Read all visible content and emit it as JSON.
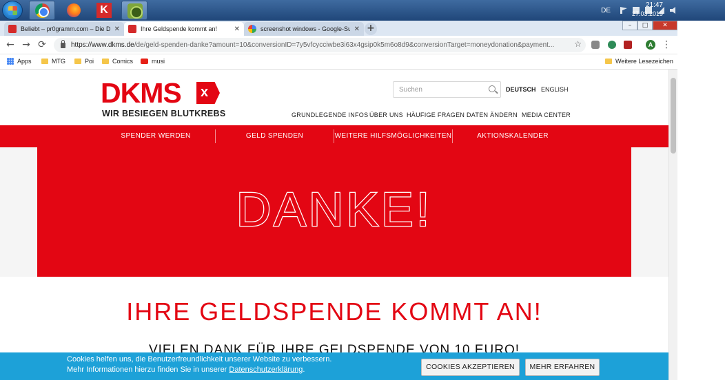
{
  "taskbar": {
    "tray_language": "DE",
    "clock_time": "21:47",
    "clock_date": "27.03.2019"
  },
  "window": {
    "minimize": "–",
    "maximize": "□",
    "close": "✕"
  },
  "tabs": [
    {
      "title": "Beliebt – pr0gramm.com – Die D",
      "active": false
    },
    {
      "title": "Ihre Geldspende kommt an!",
      "active": true
    },
    {
      "title": "screenshot windows - Google-Su",
      "active": false
    }
  ],
  "new_tab_label": "+",
  "toolbar": {
    "back": "←",
    "forward": "→",
    "reload": "⟳",
    "url_host": "https://www.dkms.de",
    "url_path": "/de/geld-spenden-danke?amount=10&conversionID=7y5vfcycciwbe3i63x4gsip0k5m6o8d9&conversionTarget=moneydonation&payment...",
    "star": "☆",
    "profile_initial": "A",
    "menu": "⋮"
  },
  "bookmarks": {
    "items": [
      "Apps",
      "MTG",
      "Poi",
      "Comics",
      "musi"
    ],
    "other": "Weitere Lesezeichen"
  },
  "site": {
    "logo": "DKMS",
    "logo_mark": "x",
    "tagline": "WIR BESIEGEN BLUTKREBS",
    "search_placeholder": "Suchen",
    "languages": [
      "DEUTSCH",
      "ENGLISH"
    ],
    "meta_nav": [
      "GRUNDLEGENDE INFOS",
      "ÜBER UNS",
      "HÄUFIGE FRAGEN",
      "DATEN ÄNDERN",
      "MEDIA CENTER"
    ],
    "main_nav": [
      "SPENDER WERDEN",
      "GELD SPENDEN",
      "WEITERE HILFSMÖGLICHKEITEN",
      "AKTIONSKALENDER"
    ],
    "hero_title": "DANKE!",
    "heading": "IHRE GELDSPENDE KOMMT AN!",
    "subheading": "VIELEN DANK FÜR IHRE GELDSPENDE VON 10 EURO!",
    "brand_color": "#e30613"
  },
  "cookie": {
    "line1": "Cookies helfen uns, die Benutzerfreundlichkeit unserer Website zu verbessern.",
    "line2_prefix": "Mehr Informationen hierzu finden Sie in unserer ",
    "line2_link": "Datenschutzerklärung",
    "line2_suffix": ".",
    "accept": "COOKIES AKZEPTIEREN",
    "more": "MEHR ERFAHREN",
    "bar_color": "#1da1d8"
  }
}
